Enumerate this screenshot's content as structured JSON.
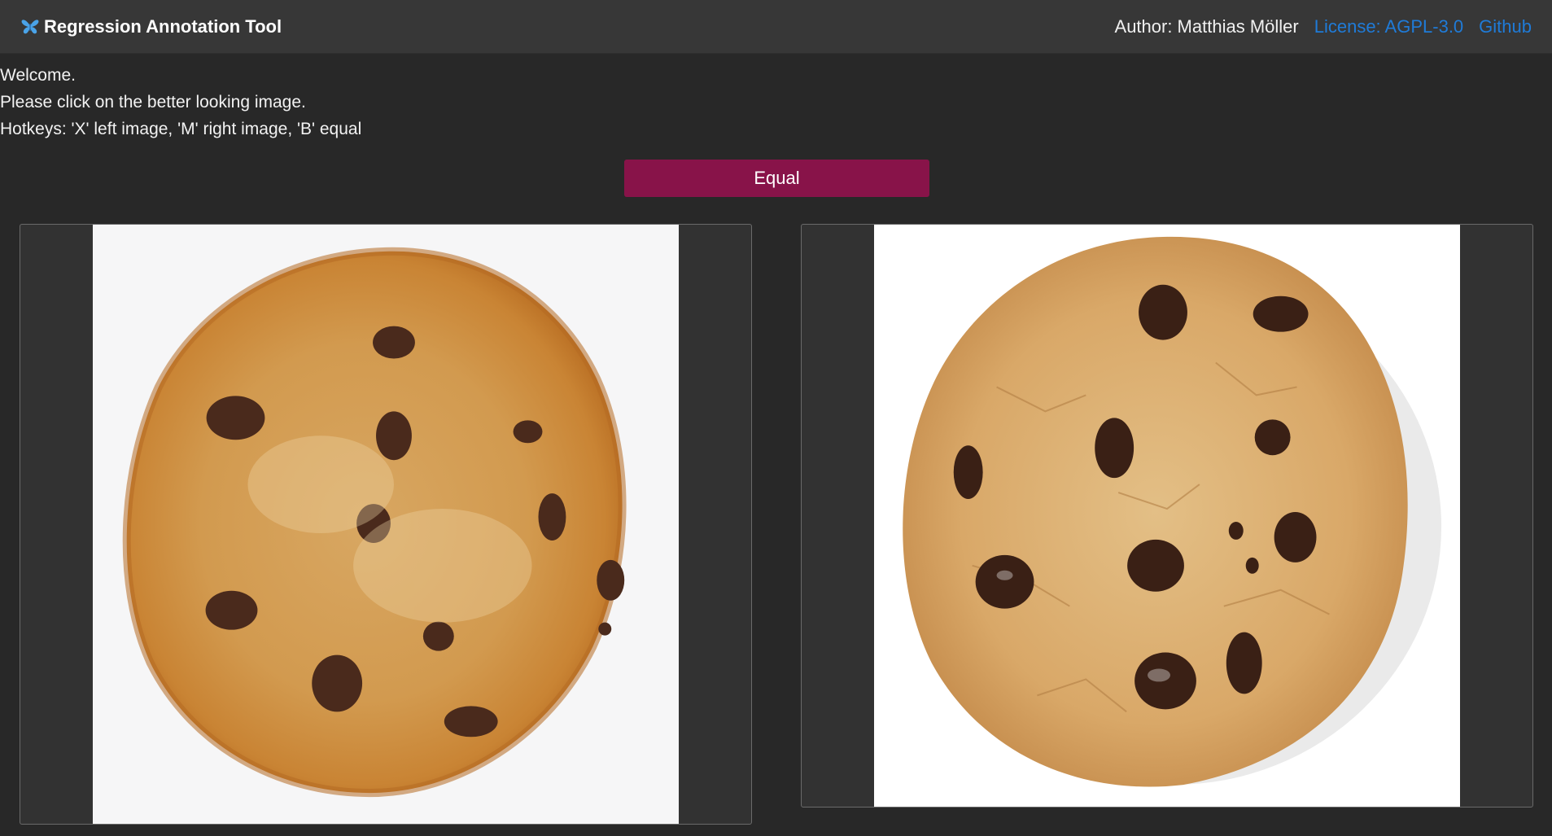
{
  "header": {
    "app_title": "Regression Annotation Tool",
    "brand_icon": "butterfly-icon",
    "author": "Author: Matthias Möller",
    "license_link": "License: AGPL-3.0",
    "github_link": "Github",
    "link_color": "#1f7bd8"
  },
  "intro": {
    "welcome": "Welcome.",
    "instruction": "Please click on the better looking image.",
    "hotkeys": "Hotkeys: 'X' left image, 'M' right image, 'B' equal"
  },
  "equal_button": {
    "label": "Equal",
    "color": "#881349"
  },
  "images": {
    "left": {
      "subject": "chocolate chip cookie",
      "background": "#f6f6f7"
    },
    "right": {
      "subject": "chocolate chip cookie",
      "background": "#ffffff"
    }
  }
}
